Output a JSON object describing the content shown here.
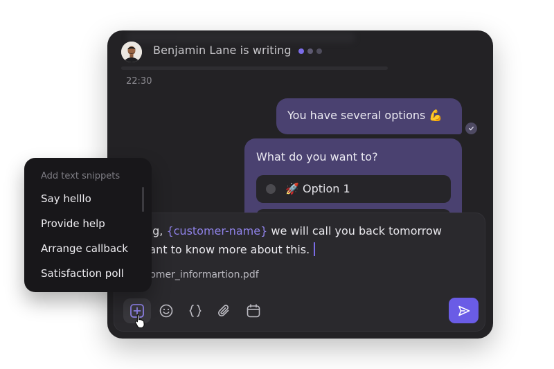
{
  "header": {
    "title": "Benjamin Lane is writing",
    "typing_dot_colors": [
      "#7b6ce8",
      "#5e5a72",
      "#4f4d5c"
    ]
  },
  "timestamp": "22:30",
  "messages": {
    "outgoing": "You have several options 💪",
    "options_question": "What do you want to?",
    "option_1": "🚀 Option 1"
  },
  "composer": {
    "line1_prefix": "uzing, ",
    "line1_variable": "{customer-name}",
    "line1_suffix": " we will call you back tomorrow",
    "line2": "u want to know more about this.",
    "attachment": "customer_informartion.pdf"
  },
  "toolbar": {
    "icons": [
      "add-snippet-icon",
      "emoji-icon",
      "variable-braces-icon",
      "paperclip-icon",
      "calendar-icon",
      "send-icon"
    ]
  },
  "snippets": {
    "title": "Add text snippets",
    "items": [
      "Say helllo",
      "Provide help",
      "Arrange callback",
      "Satisfaction poll"
    ]
  },
  "colors": {
    "accent": "#6a5ce6",
    "bubble": "#4a4170",
    "window_bg": "#232225",
    "variable_text": "#8f82e8"
  }
}
